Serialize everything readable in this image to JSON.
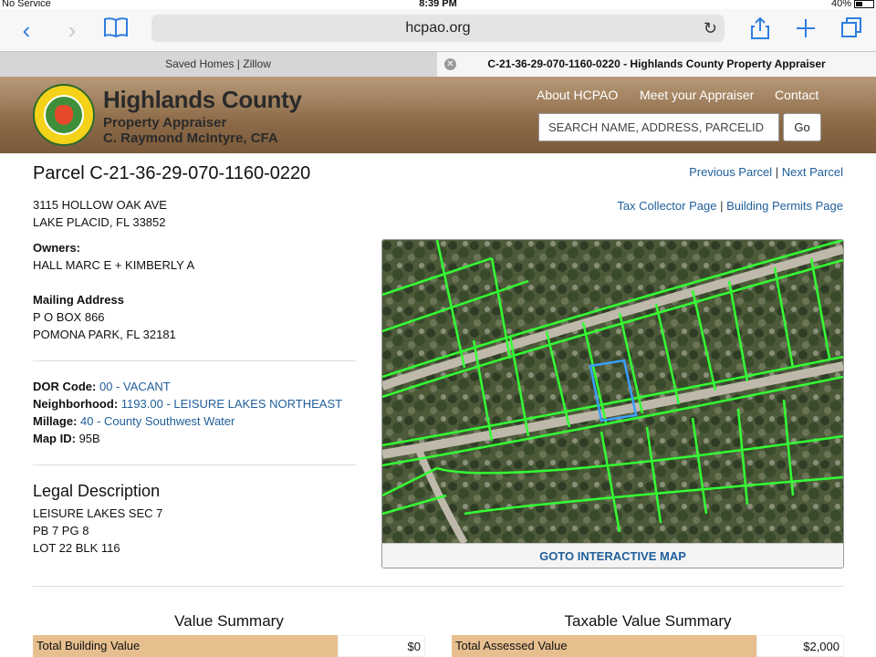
{
  "status": {
    "carrier": "No Service",
    "time": "8:39 PM",
    "battery": "40%"
  },
  "browser": {
    "url": "hcpao.org",
    "tabs": [
      {
        "label": "Saved Homes | Zillow"
      },
      {
        "label": "C-21-36-29-070-1160-0220 - Highlands County Property Appraiser"
      }
    ]
  },
  "header": {
    "title": "Highlands County",
    "subtitle1": "Property Appraiser",
    "subtitle2": "C. Raymond McIntyre, CFA",
    "nav": [
      "About HCPAO",
      "Meet your Appraiser",
      "Contact"
    ],
    "search_placeholder": "SEARCH NAME, ADDRESS, PARCELID",
    "go_label": "Go"
  },
  "parcel": {
    "title": "Parcel C-21-36-29-070-1160-0220",
    "prev": "Previous Parcel",
    "next": "Next Parcel",
    "tax_collector": "Tax Collector Page",
    "building_permits": "Building Permits Page",
    "address1": "3115 HOLLOW OAK AVE",
    "address2": "LAKE PLACID, FL 33852",
    "owners_label": "Owners:",
    "owners": "HALL MARC E + KIMBERLY A",
    "mailing_label": "Mailing Address",
    "mailing1": "P O BOX 866",
    "mailing2": "POMONA PARK, FL 32181",
    "dor_label": "DOR Code:",
    "dor_value": "00 - VACANT",
    "nbhd_label": "Neighborhood:",
    "nbhd_value": "1193.00 - LEISURE LAKES NORTHEAST",
    "millage_label": "Millage:",
    "millage_value": "40 - County Southwest Water",
    "mapid_label": "Map ID:",
    "mapid_value": "95B",
    "legal_title": "Legal Description",
    "legal1": "LEISURE LAKES SEC 7",
    "legal2": "PB 7 PG 8",
    "legal3": "LOT 22 BLK 116",
    "goto_map": "GOTO INTERACTIVE MAP"
  },
  "value_summary": {
    "title": "Value Summary",
    "row_label": "Total Building Value",
    "row_value": "$0"
  },
  "taxable_summary": {
    "title": "Taxable Value Summary",
    "row_label": "Total Assessed Value",
    "row_value": "$2,000"
  },
  "colors": {
    "accent_link": "#1f5e9b",
    "header_brown": "#8c6a48",
    "summary_tan": "#e7bf8f",
    "parcel_line": "#33ff33",
    "selected_parcel": "#3aa0ff"
  }
}
